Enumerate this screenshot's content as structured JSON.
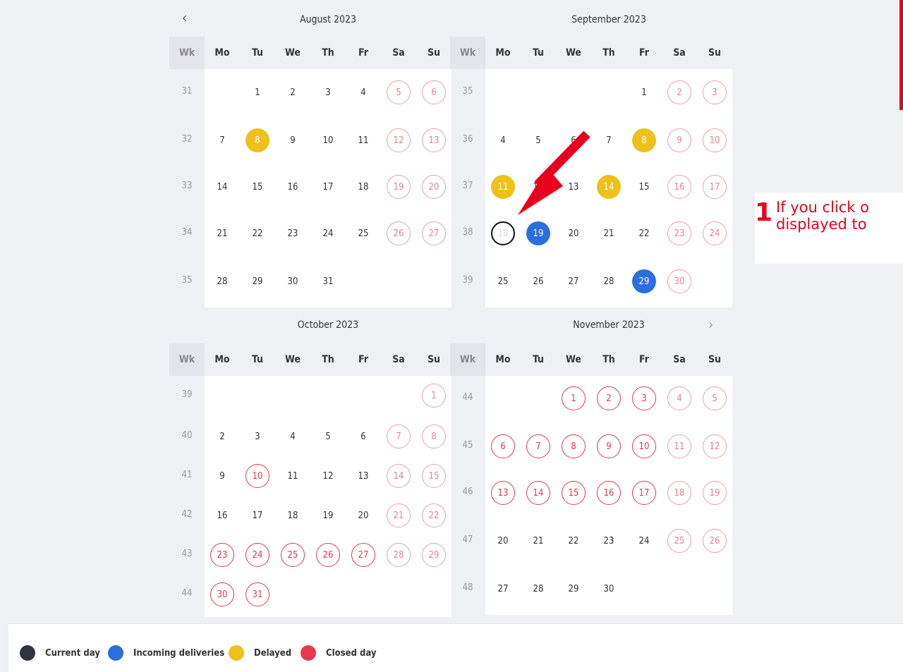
{
  "calendar": {
    "prev_icon": "chevron-left-icon",
    "next_icon": "chevron-right-icon",
    "prev_glyph": "‹",
    "next_glyph": "›",
    "weekday_headers": [
      "Wk",
      "Mo",
      "Tu",
      "We",
      "Th",
      "Fr",
      "Sa",
      "Su"
    ],
    "months": [
      {
        "title": "August 2023",
        "weeks": [
          {
            "wk": "31",
            "days": [
              null,
              {
                "n": "1"
              },
              {
                "n": "2"
              },
              {
                "n": "3"
              },
              {
                "n": "4"
              },
              {
                "n": "5",
                "s": "weekend"
              },
              {
                "n": "6",
                "s": "weekend"
              }
            ]
          },
          {
            "wk": "32",
            "days": [
              {
                "n": "7"
              },
              {
                "n": "8",
                "s": "delayed"
              },
              {
                "n": "9"
              },
              {
                "n": "10"
              },
              {
                "n": "11"
              },
              {
                "n": "12",
                "s": "weekend"
              },
              {
                "n": "13",
                "s": "weekend"
              }
            ]
          },
          {
            "wk": "33",
            "days": [
              {
                "n": "14"
              },
              {
                "n": "15"
              },
              {
                "n": "16"
              },
              {
                "n": "17"
              },
              {
                "n": "18"
              },
              {
                "n": "19",
                "s": "weekend"
              },
              {
                "n": "20",
                "s": "weekend"
              }
            ]
          },
          {
            "wk": "34",
            "days": [
              {
                "n": "21"
              },
              {
                "n": "22"
              },
              {
                "n": "23"
              },
              {
                "n": "24"
              },
              {
                "n": "25"
              },
              {
                "n": "26",
                "s": "weekend"
              },
              {
                "n": "27",
                "s": "weekend"
              }
            ]
          },
          {
            "wk": "35",
            "days": [
              {
                "n": "28"
              },
              {
                "n": "29"
              },
              {
                "n": "30"
              },
              {
                "n": "31"
              },
              null,
              null,
              null
            ]
          }
        ]
      },
      {
        "title": "September 2023",
        "weeks": [
          {
            "wk": "35",
            "days": [
              null,
              null,
              null,
              null,
              {
                "n": "1"
              },
              {
                "n": "2",
                "s": "weekend"
              },
              {
                "n": "3",
                "s": "weekend"
              }
            ]
          },
          {
            "wk": "36",
            "days": [
              {
                "n": "4"
              },
              {
                "n": "5"
              },
              {
                "n": "6"
              },
              {
                "n": "7"
              },
              {
                "n": "8",
                "s": "delayed"
              },
              {
                "n": "9",
                "s": "weekend"
              },
              {
                "n": "10",
                "s": "weekend"
              }
            ]
          },
          {
            "wk": "37",
            "days": [
              {
                "n": "11",
                "s": "delayed"
              },
              {
                "n": "12"
              },
              {
                "n": "13"
              },
              {
                "n": "14",
                "s": "delayed"
              },
              {
                "n": "15"
              },
              {
                "n": "16",
                "s": "weekend"
              },
              {
                "n": "17",
                "s": "weekend"
              }
            ]
          },
          {
            "wk": "38",
            "days": [
              {
                "n": "18",
                "s": "current"
              },
              {
                "n": "19",
                "s": "incoming"
              },
              {
                "n": "20"
              },
              {
                "n": "21"
              },
              {
                "n": "22"
              },
              {
                "n": "23",
                "s": "weekend"
              },
              {
                "n": "24",
                "s": "weekend"
              }
            ]
          },
          {
            "wk": "39",
            "days": [
              {
                "n": "25"
              },
              {
                "n": "26"
              },
              {
                "n": "27"
              },
              {
                "n": "28"
              },
              {
                "n": "29",
                "s": "incoming"
              },
              {
                "n": "30",
                "s": "weekend"
              },
              null
            ]
          }
        ]
      },
      {
        "title": "October 2023",
        "weeks": [
          {
            "wk": "39",
            "days": [
              null,
              null,
              null,
              null,
              null,
              null,
              {
                "n": "1",
                "s": "weekend"
              }
            ]
          },
          {
            "wk": "40",
            "days": [
              {
                "n": "2"
              },
              {
                "n": "3"
              },
              {
                "n": "4"
              },
              {
                "n": "5"
              },
              {
                "n": "6"
              },
              {
                "n": "7",
                "s": "weekend"
              },
              {
                "n": "8",
                "s": "weekend"
              }
            ]
          },
          {
            "wk": "41",
            "days": [
              {
                "n": "9"
              },
              {
                "n": "10",
                "s": "closed"
              },
              {
                "n": "11"
              },
              {
                "n": "12"
              },
              {
                "n": "13"
              },
              {
                "n": "14",
                "s": "weekend"
              },
              {
                "n": "15",
                "s": "weekend"
              }
            ]
          },
          {
            "wk": "42",
            "days": [
              {
                "n": "16"
              },
              {
                "n": "17"
              },
              {
                "n": "18"
              },
              {
                "n": "19"
              },
              {
                "n": "20"
              },
              {
                "n": "21",
                "s": "weekend"
              },
              {
                "n": "22",
                "s": "weekend"
              }
            ]
          },
          {
            "wk": "43",
            "days": [
              {
                "n": "23",
                "s": "closed"
              },
              {
                "n": "24",
                "s": "closed"
              },
              {
                "n": "25",
                "s": "closed"
              },
              {
                "n": "26",
                "s": "closed"
              },
              {
                "n": "27",
                "s": "closed"
              },
              {
                "n": "28",
                "s": "weekend"
              },
              {
                "n": "29",
                "s": "weekend"
              }
            ]
          },
          {
            "wk": "44",
            "days": [
              {
                "n": "30",
                "s": "closed"
              },
              {
                "n": "31",
                "s": "closed"
              },
              null,
              null,
              null,
              null,
              null
            ]
          }
        ]
      },
      {
        "title": "November 2023",
        "weeks": [
          {
            "wk": "44",
            "days": [
              null,
              null,
              {
                "n": "1",
                "s": "closed"
              },
              {
                "n": "2",
                "s": "closed"
              },
              {
                "n": "3",
                "s": "closed"
              },
              {
                "n": "4",
                "s": "weekend"
              },
              {
                "n": "5",
                "s": "weekend"
              }
            ]
          },
          {
            "wk": "45",
            "days": [
              {
                "n": "6",
                "s": "closed"
              },
              {
                "n": "7",
                "s": "closed"
              },
              {
                "n": "8",
                "s": "closed"
              },
              {
                "n": "9",
                "s": "closed"
              },
              {
                "n": "10",
                "s": "closed"
              },
              {
                "n": "11",
                "s": "weekend"
              },
              {
                "n": "12",
                "s": "weekend"
              }
            ]
          },
          {
            "wk": "46",
            "days": [
              {
                "n": "13",
                "s": "closed"
              },
              {
                "n": "14",
                "s": "closed"
              },
              {
                "n": "15",
                "s": "closed"
              },
              {
                "n": "16",
                "s": "closed"
              },
              {
                "n": "17",
                "s": "closed"
              },
              {
                "n": "18",
                "s": "weekend"
              },
              {
                "n": "19",
                "s": "weekend"
              }
            ]
          },
          {
            "wk": "47",
            "days": [
              {
                "n": "20"
              },
              {
                "n": "21"
              },
              {
                "n": "22"
              },
              {
                "n": "23"
              },
              {
                "n": "24"
              },
              {
                "n": "25",
                "s": "weekend"
              },
              {
                "n": "26",
                "s": "weekend"
              }
            ]
          },
          {
            "wk": "48",
            "days": [
              {
                "n": "27"
              },
              {
                "n": "28"
              },
              {
                "n": "29"
              },
              {
                "n": "30"
              },
              null,
              null,
              null
            ]
          }
        ]
      }
    ]
  },
  "legend": [
    {
      "label": "Current day",
      "color": "#2e3440"
    },
    {
      "label": "Incoming deliveries",
      "color": "#2a6fdb"
    },
    {
      "label": "Delayed",
      "color": "#eec01a"
    },
    {
      "label": "Closed day",
      "color": "#e8384f"
    }
  ],
  "annotation": {
    "number": "1",
    "line1": "If you click o",
    "line2": "displayed to",
    "color": "#e8001c"
  }
}
